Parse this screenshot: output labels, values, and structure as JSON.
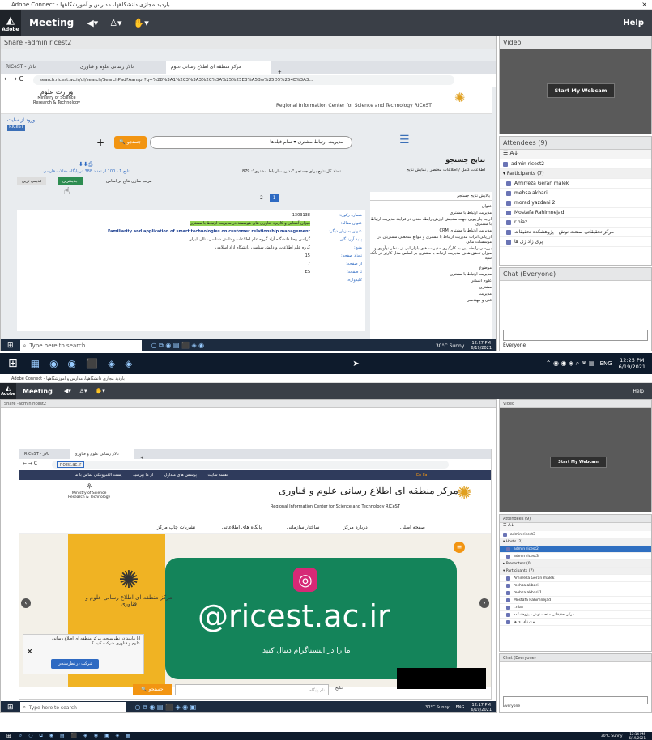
{
  "top": {
    "window_title": "Adobe Connect - باردید مجازی دانشگاهها، مدارس و آموزشگاهها",
    "meeting": {
      "logo": "Adobe",
      "menu": "Meeting",
      "help": "Help"
    },
    "share": {
      "title": "Share -admin ricest2"
    },
    "browser": {
      "tabs": [
        "RICeST - نالار",
        "تالار رسانی علوم و فناوری",
        "مرکز منطقه ای اطلاع رسانی علوم"
      ],
      "url": "search.ricest.ac.ir/dl/search/SearchPad?Aanspr?q=%28%3A1%2C3%3A3%2C%3A%25%25E3%A5Bw%25D5%254E%3A3...",
      "center_en": "Regional Information Center for Science and Technology RICeST",
      "ministry": [
        "Ministry of Science",
        "Research & Technology"
      ],
      "login": "ورود از سایت",
      "search_btn": "جستجو",
      "search_value": "مدیریت ارتباط مشتری",
      "field_select": "تمام فیلدها",
      "results_head": "نتایج جستجو",
      "results_radio": "اطلاعات کامل / اطلاعات مختصر / نمایش نتایج",
      "sort_label": "مرتب سازی نتایج بر اساس",
      "sort_a": "جدیدترین",
      "sort_b": "قدیمی ترین",
      "count_text": "تعداد کل نتایج برای جستجو \"مدیریت ارتباط مشتری\": 879 ",
      "page_range": "نتایج 1 - 100 از تعداد 388 در پایگاه مقالات فارسی",
      "pager": [
        "1",
        "2"
      ],
      "filters_head": "پالایش نتایج جستجو",
      "filter_group1": "عنوان",
      "filters1": [
        "مدیریت ارتباط با مشتری",
        "ارایه چارچوبی جهت سنجش ارزش رابطه مندی در فرایند مدیریت ارتباط با مشتری",
        "مدیریت ارتباط با مشتری CRM",
        "ارزیابی اثرات مدیریت ارتباط با مشتری و موانع شخصی مشتریان در موسسات مالی",
        "بررسی رابطه بین به کارگیری مدیریت های بازاریابی از منظر نوآوری و میزان تحقق هدف مدیریت ارتباط با مشتری بر اساس مدل کارتر در بانک سپه"
      ],
      "filter_group2": "موضوع",
      "filters2": [
        "مدیریت ارتباط با مشتری",
        "علوم انسانی",
        "مشتری",
        "مدیریت",
        "فنی و مهندسی"
      ],
      "record": {
        "labels": [
          "شماره رکورد:",
          "عنوان مقاله:",
          "عنوان به زبان دیگر:",
          "پدید آورندگان:",
          "منبع:",
          "تعداد صفحه:",
          "از صفحه:",
          "تا صفحه:",
          "کلیدواژه:"
        ],
        "id": "1303138",
        "title": "میزان آشنایی و کاربرد فناوری های هوشمند در مدیریت ارتباط با مشتری",
        "title_en": "Familiarity and application of smart technologies on customer relationship management",
        "authors": "گرانس رضا دانشگاه آزاد گروه علم اطلاعات و دانش شناسی، نالر، ایران",
        "source": "گروه علم اطلاعات و دانش شناسی دانشگاه آزاد اسلامی",
        "pages": "15",
        "from": "7",
        "to": "ES"
      }
    },
    "taskbar_inner": {
      "search": "Type here to search",
      "weather": "30°C Sunny",
      "time": "12:27 PM",
      "date": "6/19/2021"
    },
    "video": {
      "title": "Video",
      "button": "Start My Webcam"
    },
    "attendees": {
      "title": "Attendees (9)",
      "host": "admin ricest2",
      "participants_head": "Participants (7)",
      "participants": [
        "Amirreza Geran malek",
        "mehsa akbari",
        "morad yazdani 2",
        "Mostafa Rahimnejad",
        "r.niaz",
        "مرکز تحقیقاتی صنعت نوش - پژوهشکده تحقیقات",
        "پری زاد زی ها"
      ]
    },
    "chat": {
      "title": "Chat (Everyone)",
      "to": "Everyone"
    },
    "taskbar_outer": {
      "lang": "ENG",
      "time": "12:25 PM",
      "date": "6/19/2021"
    }
  },
  "bottom": {
    "window_title": "Adobe Connect - باردید مجازی دانشگاهها، مدارس و آموزشگاهها",
    "meeting": {
      "logo": "Adobe",
      "menu": "Meeting",
      "help": "Help"
    },
    "share": {
      "title": "Share -admin ricest2"
    },
    "browser": {
      "tabs": [
        "RICeST - نالار",
        "تالار رسانی علوم و فناوری"
      ],
      "url": "ricest.ac.ir",
      "toplinks": [
        "تماس با ما",
        "پست الکترونیکی",
        "از ما بپرسید",
        "پرسش های متداول",
        "نقشه سایت"
      ],
      "lang": "En  Fa",
      "brand_fa": "مرکز منطقه ای اطلاع رسانی علوم و فناوری",
      "brand_en": "Regional Information Center for Science and Technology RICeST",
      "ministry": [
        "Ministry of Science",
        "Research & Technology"
      ],
      "nav": [
        "صفحه اصلی",
        "درباره مرکز",
        "ساختار سازمانی",
        "پایگاه های اطلاعاتی",
        "نشریات چاپ مرکز"
      ],
      "banner_handle": "@ricest.ac.ir",
      "banner_sub": "ما را در اینستاگرام دنبال کنید",
      "banner_logo": "مرکز منطقه ای اطلاع رسانی علوم و فناوری",
      "popup_text": "آیا مایلید در نظرسنجی مرکز منطقه ای اطلاع رسانی علوم و فناوری شرکت کنید ؟",
      "popup_btn": "شرکت در نظرسنجی",
      "search_btn": "جستجو",
      "search_ph": "نام پایگاه",
      "search_label": "نتایج"
    },
    "taskbar_inner": {
      "search": "Type here to search",
      "weather": "30°C Sunny",
      "lang": "ENG",
      "time": "12:17 PM",
      "date": "6/19/2021"
    },
    "video": {
      "title": "Video",
      "button": "Start My Webcam"
    },
    "attendees": {
      "title": "Attendees (9)",
      "host": "admin ricest3",
      "hosts_head": "Hosts (2)",
      "hosts": [
        "admin ricest2",
        "admin ricest3"
      ],
      "presenters_head": "Presenters (0)",
      "participants_head": "Participants (7)",
      "participants": [
        "Amirreza Geran malek",
        "mehsa akbari",
        "mehsa akbari 1",
        "Mostafa Rahimnejad",
        "r.niaz",
        "مرکز تحقیقاتی صنعت نوش - پژوهشکده",
        "پری زاد زی ها"
      ]
    },
    "chat": {
      "title": "Chat (Everyone)",
      "to": "Everyone"
    },
    "taskbar_outer": {
      "weather": "30°C Sunny",
      "time": "12:14 PM",
      "date": "6/19/2021"
    }
  }
}
